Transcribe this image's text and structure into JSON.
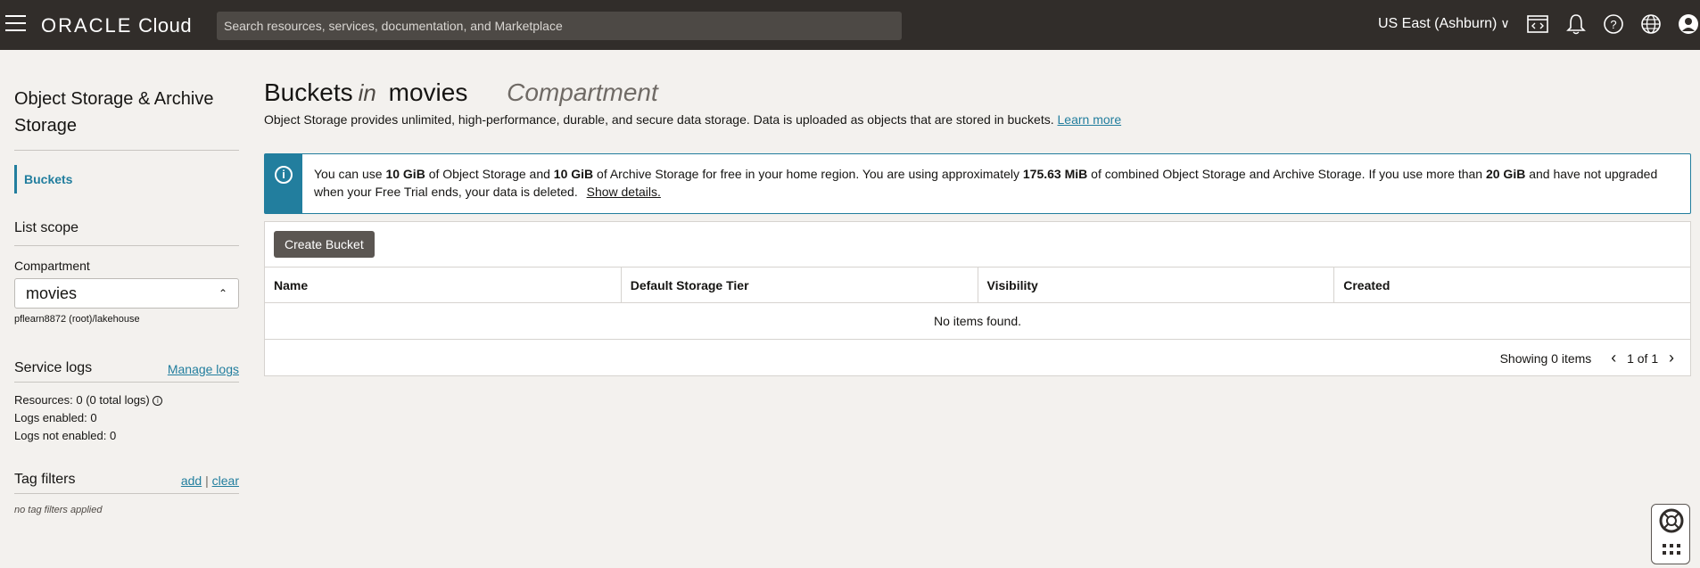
{
  "topbar": {
    "logo_oracle": "ORACLE",
    "logo_cloud": "Cloud",
    "search_placeholder": "Search resources, services, documentation, and Marketplace",
    "region": "US East (Ashburn)"
  },
  "sidebar": {
    "title": "Object Storage & Archive Storage",
    "nav_items": [
      {
        "label": "Buckets"
      }
    ],
    "list_scope_title": "List scope",
    "compartment_label": "Compartment",
    "compartment_value": "movies",
    "compartment_path": "pflearn8872 (root)/lakehouse",
    "service_logs_title": "Service logs",
    "manage_logs": "Manage logs",
    "resources_label": "Resources:",
    "resources_value": "0 (0 total logs)",
    "logs_enabled_label": "Logs enabled:",
    "logs_enabled_value": "0",
    "logs_not_enabled_label": "Logs not enabled:",
    "logs_not_enabled_value": "0",
    "tag_filters_title": "Tag filters",
    "tag_add": "add",
    "tag_sep": "|",
    "tag_clear": "clear",
    "no_tag_filters": "no tag filters applied"
  },
  "main": {
    "title_buckets": "Buckets",
    "title_in": "in",
    "title_compartment_name": "movies",
    "title_compartment": "Compartment",
    "description": "Object Storage provides unlimited, high-performance, durable, and secure data storage. Data is uploaded as objects that are stored in buckets.",
    "learn_more": "Learn more",
    "banner": {
      "t1": "You can use ",
      "b1": "10 GiB",
      "t2": " of Object Storage and ",
      "b2": "10 GiB",
      "t3": " of Archive Storage for free in your home region. You are using approximately ",
      "b3": "175.63 MiB",
      "t4": " of combined Object Storage and Archive Storage. If you use more than ",
      "b4": "20 GiB",
      "t5": " and have not upgraded when your Free Trial ends, your data is deleted.",
      "show_details": "Show details."
    },
    "create_bucket": "Create Bucket",
    "columns": [
      "Name",
      "Default Storage Tier",
      "Visibility",
      "Created"
    ],
    "empty_text": "No items found.",
    "showing": "Showing 0 items",
    "page": "1 of 1"
  },
  "colors": {
    "accent": "#227e9e",
    "topbar": "#312d2a",
    "button": "#5b5652"
  }
}
